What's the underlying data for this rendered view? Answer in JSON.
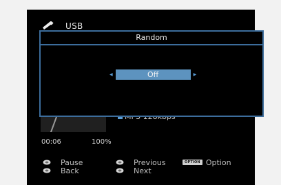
{
  "source": {
    "label": "USB",
    "icon": "usb-icon"
  },
  "dialog": {
    "title": "Random",
    "value": "Off",
    "left_arrow_icon": "arrow-left-icon",
    "right_arrow_icon": "arrow-right-icon"
  },
  "playback": {
    "format": "MP3 128kbps",
    "elapsed": "00:06",
    "progress_text": "100%",
    "progress": 1.0
  },
  "hints": [
    {
      "label": "Pause",
      "icon": "enter-button-icon"
    },
    {
      "label": "Back",
      "icon": "back-button-icon"
    },
    {
      "label": "Previous",
      "icon": "up-button-icon"
    },
    {
      "label": "Next",
      "icon": "down-button-icon"
    },
    {
      "label": "Option",
      "badge": "OPTION",
      "icon": "option-button-icon"
    }
  ],
  "colors": {
    "accent": "#3c6d9c",
    "selection": "#5d93bf",
    "background": "#000000"
  }
}
